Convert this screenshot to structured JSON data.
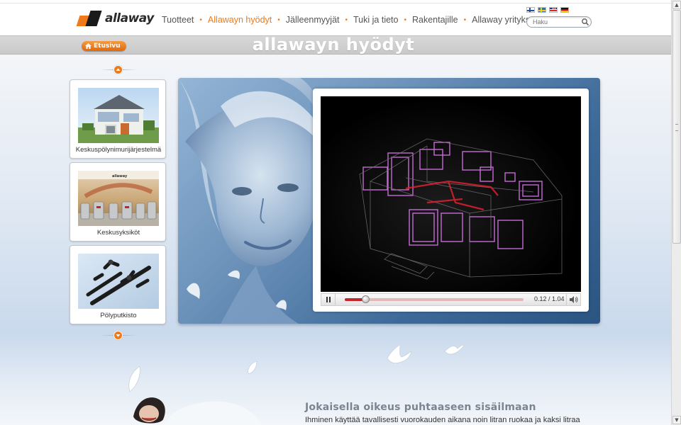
{
  "header": {
    "logo_text": "allaway",
    "nav": [
      {
        "label": "Tuotteet",
        "active": false
      },
      {
        "label": "Allawayn hyödyt",
        "active": true
      },
      {
        "label": "Jälleenmyyjät",
        "active": false
      },
      {
        "label": "Tuki ja tieto",
        "active": false
      },
      {
        "label": "Rakentajille",
        "active": false
      },
      {
        "label": "Allaway yrityksenä",
        "active": false
      }
    ],
    "languages": [
      "fi",
      "se",
      "gb",
      "de"
    ],
    "search_placeholder": "Haku"
  },
  "titlebar": {
    "home_label": "Etusivu",
    "page_title": "allawayn hyödyt"
  },
  "carousel": {
    "items": [
      {
        "label": "Keskuspölynimurijärjestelmä"
      },
      {
        "label": "Keskusyksiköt"
      },
      {
        "label": "Pölyputkisto"
      }
    ]
  },
  "video": {
    "current_time": "0.12",
    "duration": "1.04",
    "time_display": "0.12 / 1.04",
    "progress": 0.115
  },
  "content": {
    "heading": "Jokaisella oikeus puhtaaseen sisäilmaan",
    "text": "Ihminen käyttää tavallisesti vuorokauden aikana noin litran ruokaa ja kaksi litraa"
  },
  "colors": {
    "accent": "#f07a1a",
    "progress": "#c0262a"
  }
}
